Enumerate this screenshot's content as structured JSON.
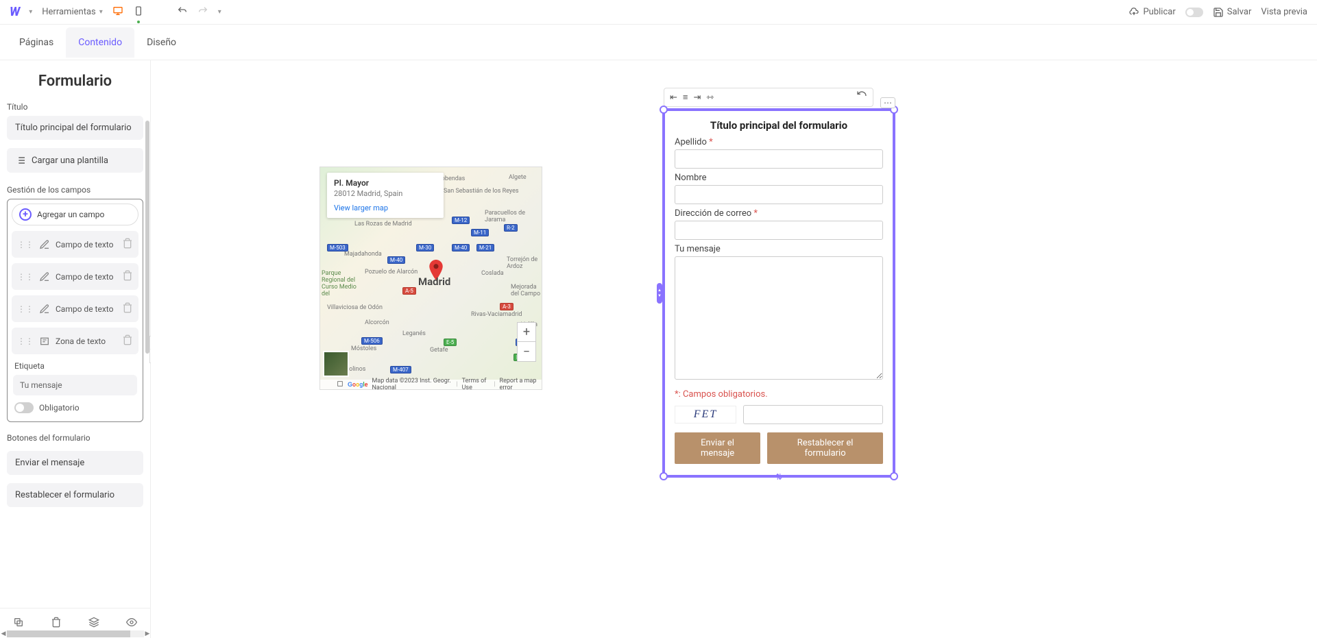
{
  "topbar": {
    "tools": "Herramientas",
    "publish": "Publicar",
    "save": "Salvar",
    "preview": "Vista previa"
  },
  "tabs": {
    "pages": "Páginas",
    "content": "Contenido",
    "design": "Diseño"
  },
  "sidebar": {
    "title": "Formulario",
    "titleLabel": "Título",
    "titleValue": "Título principal del formulario",
    "loadTemplate": "Cargar una plantilla",
    "fieldsSection": "Gestión de los campos",
    "addField": "Agregar un campo",
    "fields": [
      {
        "label": "Campo de texto"
      },
      {
        "label": "Campo de texto"
      },
      {
        "label": "Campo de texto"
      },
      {
        "label": "Zona de texto"
      }
    ],
    "etiqueta": "Etiqueta",
    "etiquetaValue": "Tu mensaje",
    "obligatorio": "Obligatorio",
    "buttonsSection": "Botones del formulario",
    "btnSend": "Enviar el mensaje",
    "btnReset": "Restablecer el formulario"
  },
  "map": {
    "infoTitle": "Pl. Mayor",
    "infoAddr": "28012 Madrid, Spain",
    "viewLarger": "View larger map",
    "city": "Madrid",
    "attrData": "Map data ©2023 Inst. Geogr. Nacional",
    "attrTerms": "Terms of Use",
    "attrReport": "Report a map error",
    "towns": {
      "alcobendas": "Alcobendas",
      "sansebastian": "San Sebastián de los Reyes",
      "paracuellos": "Paracuellos de Jarama",
      "algete": "Algete",
      "torrejon": "Torrejón de Ardoz",
      "coslada": "Coslada",
      "mejorada": "Mejorada del Campo",
      "rozas": "Las Rozas de Madrid",
      "majadahonda": "Majadahonda",
      "pozuelo": "Pozuelo de Alarcón",
      "villaviciosa": "Villaviciosa de Odón",
      "alcorcon": "Alcorcón",
      "mostoles": "Móstoles",
      "arroyomolinos": "Arroyomolinos",
      "leganes": "Leganés",
      "getafe": "Getafe",
      "rivas": "Rivas-Vaciamadrid",
      "velilla": "Velilla de Ta",
      "parque": "Parque Regional del Curso Medio del"
    }
  },
  "form": {
    "title": "Título principal del formulario",
    "apellido": "Apellido",
    "nombre": "Nombre",
    "correo": "Dirección de correo",
    "mensaje": "Tu mensaje",
    "required": "*: Campos obligatorios.",
    "captcha": "FET",
    "send": "Enviar el mensaje",
    "reset": "Restablecer el formulario"
  }
}
